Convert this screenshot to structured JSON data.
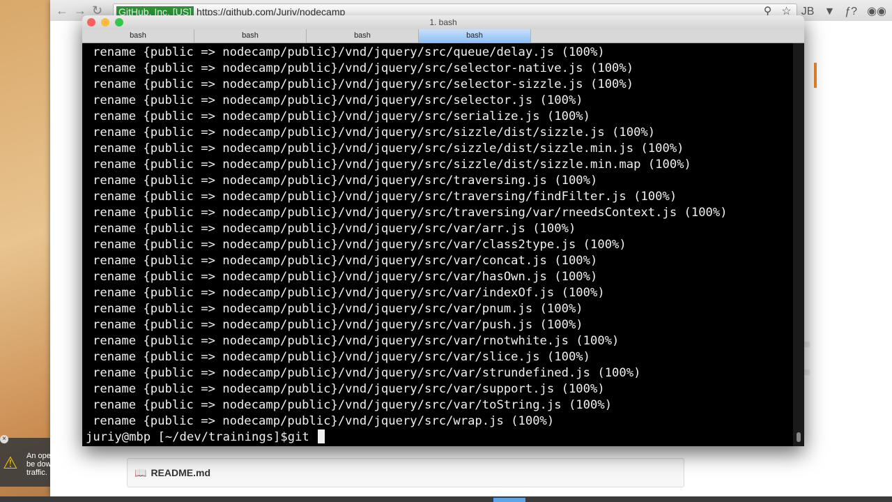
{
  "browser": {
    "address": {
      "secure_label": "GitHub, Inc. [US]",
      "url": "https://github.com/Juriv/nodecamp"
    },
    "readme_title": "README.md"
  },
  "notification": {
    "text": "An ope\nbe dow\ntraffic."
  },
  "terminal": {
    "title": "1. bash",
    "tabs": [
      "bash",
      "bash",
      "bash",
      "bash"
    ],
    "active_tab": 3,
    "lines": [
      "rename {public => nodecamp/public}/vnd/jquery/src/queue/delay.js (100%)",
      "rename {public => nodecamp/public}/vnd/jquery/src/selector-native.js (100%)",
      "rename {public => nodecamp/public}/vnd/jquery/src/selector-sizzle.js (100%)",
      "rename {public => nodecamp/public}/vnd/jquery/src/selector.js (100%)",
      "rename {public => nodecamp/public}/vnd/jquery/src/serialize.js (100%)",
      "rename {public => nodecamp/public}/vnd/jquery/src/sizzle/dist/sizzle.js (100%)",
      "rename {public => nodecamp/public}/vnd/jquery/src/sizzle/dist/sizzle.min.js (100%)",
      "rename {public => nodecamp/public}/vnd/jquery/src/sizzle/dist/sizzle.min.map (100%)",
      "rename {public => nodecamp/public}/vnd/jquery/src/traversing.js (100%)",
      "rename {public => nodecamp/public}/vnd/jquery/src/traversing/findFilter.js (100%)",
      "rename {public => nodecamp/public}/vnd/jquery/src/traversing/var/rneedsContext.js (100%)",
      "rename {public => nodecamp/public}/vnd/jquery/src/var/arr.js (100%)",
      "rename {public => nodecamp/public}/vnd/jquery/src/var/class2type.js (100%)",
      "rename {public => nodecamp/public}/vnd/jquery/src/var/concat.js (100%)",
      "rename {public => nodecamp/public}/vnd/jquery/src/var/hasOwn.js (100%)",
      "rename {public => nodecamp/public}/vnd/jquery/src/var/indexOf.js (100%)",
      "rename {public => nodecamp/public}/vnd/jquery/src/var/pnum.js (100%)",
      "rename {public => nodecamp/public}/vnd/jquery/src/var/push.js (100%)",
      "rename {public => nodecamp/public}/vnd/jquery/src/var/rnotwhite.js (100%)",
      "rename {public => nodecamp/public}/vnd/jquery/src/var/slice.js (100%)",
      "rename {public => nodecamp/public}/vnd/jquery/src/var/strundefined.js (100%)",
      "rename {public => nodecamp/public}/vnd/jquery/src/var/support.js (100%)",
      "rename {public => nodecamp/public}/vnd/jquery/src/var/toString.js (100%)",
      "rename {public => nodecamp/public}/vnd/jquery/src/wrap.js (100%)"
    ],
    "prompt": "juriy@mbp [~/dev/trainings]$git "
  },
  "colors": {
    "terminal_bg": "#000000",
    "terminal_fg": "#f0f0f0",
    "active_tab": "#8ec0f6",
    "secure_badge": "#2e9a3a"
  }
}
